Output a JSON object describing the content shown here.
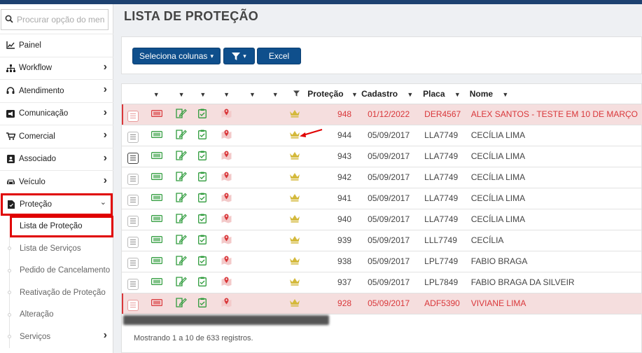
{
  "search": {
    "placeholder": "Procurar opção do menu"
  },
  "menu": [
    {
      "label": "Painel",
      "icon": "line-chart-icon",
      "chevron": false
    },
    {
      "label": "Workflow",
      "icon": "sitemap-icon",
      "chevron": true
    },
    {
      "label": "Atendimento",
      "icon": "headset-icon",
      "chevron": true
    },
    {
      "label": "Comunicação",
      "icon": "megaphone-icon",
      "chevron": true
    },
    {
      "label": "Comercial",
      "icon": "cart-icon",
      "chevron": true
    },
    {
      "label": "Associado",
      "icon": "id-card-icon",
      "chevron": true
    },
    {
      "label": "Veículo",
      "icon": "car-icon",
      "chevron": true
    },
    {
      "label": "Proteção",
      "icon": "document-icon",
      "chevron": true,
      "expanded": true
    }
  ],
  "submenu": [
    {
      "label": "Lista de Proteção",
      "active": true
    },
    {
      "label": "Lista de Serviços"
    },
    {
      "label": "Pedido de Cancelamento"
    },
    {
      "label": "Reativação de Proteção"
    },
    {
      "label": "Alteração"
    },
    {
      "label": "Serviços",
      "chevron": true
    }
  ],
  "page": {
    "title": "LISTA DE PROTEÇÃO"
  },
  "toolbar": {
    "columns_label": "Seleciona colunas",
    "excel_label": "Excel"
  },
  "table": {
    "headers": {
      "protecao": "Proteção",
      "cadastro": "Cadastro",
      "placa": "Placa",
      "nome": "Nome"
    },
    "rows": [
      {
        "protecao": "948",
        "cadastro": "01/12/2022",
        "placa": "DER4567",
        "nome": "ALEX SANTOS - TESTE EM 10 DE MARÇO",
        "highlight": true
      },
      {
        "protecao": "944",
        "cadastro": "05/09/2017",
        "placa": "LLA7749",
        "nome": "CECÍLIA LIMA"
      },
      {
        "protecao": "943",
        "cadastro": "05/09/2017",
        "placa": "LLA7749",
        "nome": "CECÍLIA LIMA"
      },
      {
        "protecao": "942",
        "cadastro": "05/09/2017",
        "placa": "LLA7749",
        "nome": "CECÍLIA LIMA"
      },
      {
        "protecao": "941",
        "cadastro": "05/09/2017",
        "placa": "LLA7749",
        "nome": "CECÍLIA LIMA"
      },
      {
        "protecao": "940",
        "cadastro": "05/09/2017",
        "placa": "LLA7749",
        "nome": "CECÍLIA LIMA"
      },
      {
        "protecao": "939",
        "cadastro": "05/09/2017",
        "placa": "LLL7749",
        "nome": "CECÍLIA"
      },
      {
        "protecao": "938",
        "cadastro": "05/09/2017",
        "placa": "LPL7749",
        "nome": "FABIO BRAGA"
      },
      {
        "protecao": "937",
        "cadastro": "05/09/2017",
        "placa": "LPL7849",
        "nome": "FABIO BRAGA DA SILVEIR"
      },
      {
        "protecao": "928",
        "cadastro": "05/09/2017",
        "placa": "ADF5390",
        "nome": "VIVIANE LIMA",
        "highlight": true
      }
    ]
  },
  "footer": {
    "info": "Mostrando 1 a 10 de 633 registros."
  },
  "colors": {
    "brand": "#0f4f8c",
    "highlight_bg": "#f5dede",
    "highlight_text": "#d9373a",
    "crown": "#d4b93c",
    "green_icon": "#2e9b3b",
    "red_icon": "#d9373a",
    "active_outline": "#e00000"
  }
}
